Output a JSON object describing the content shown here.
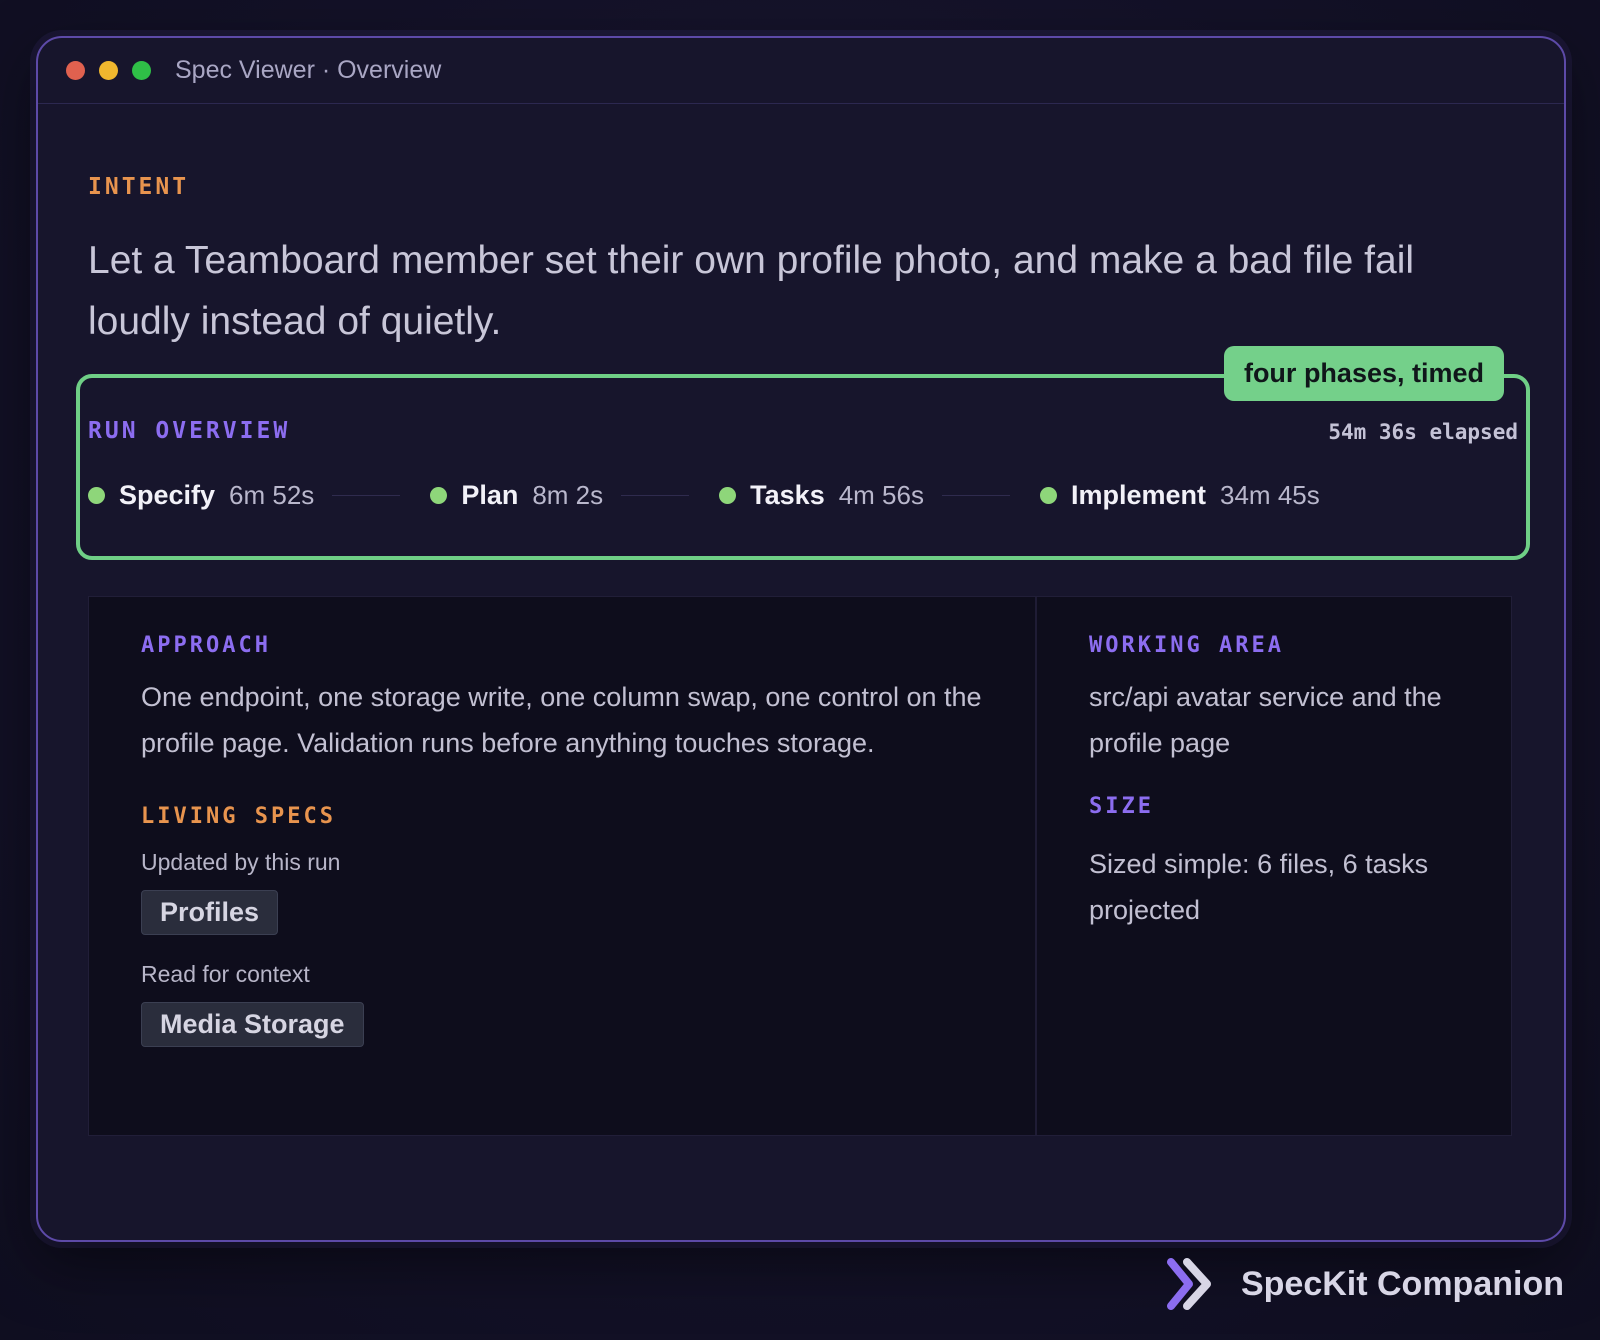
{
  "window": {
    "title": "Spec Viewer · Overview"
  },
  "intent": {
    "label": "INTENT",
    "text": "Let a Teamboard member set their own profile photo, and make a bad file fail loudly instead of quietly."
  },
  "run": {
    "badge": "four phases, timed",
    "label": "RUN OVERVIEW",
    "elapsed": "54m 36s elapsed",
    "phases": [
      {
        "name": "Specify",
        "time": "6m 52s"
      },
      {
        "name": "Plan",
        "time": "8m 2s"
      },
      {
        "name": "Tasks",
        "time": "4m 56s"
      },
      {
        "name": "Implement",
        "time": "34m 45s"
      }
    ]
  },
  "approach": {
    "label": "APPROACH",
    "text": "One endpoint, one storage write, one column swap, one control on the profile page. Validation runs before anything touches storage."
  },
  "living_specs": {
    "label": "LIVING SPECS",
    "updated_label": "Updated by this run",
    "updated_chip": "Profiles",
    "context_label": "Read for context",
    "context_chip": "Media Storage"
  },
  "working_area": {
    "label": "WORKING AREA",
    "text": "src/api avatar service and the profile page"
  },
  "size": {
    "label": "SIZE",
    "text": "Sized simple: 6 files, 6 tasks projected"
  },
  "brand": {
    "name": "SpecKit Companion"
  },
  "colors": {
    "accent_purple": "#8c6df0",
    "accent_orange": "#e8944e",
    "highlight_green": "#74d08a",
    "phase_dot": "#8ed67a"
  }
}
